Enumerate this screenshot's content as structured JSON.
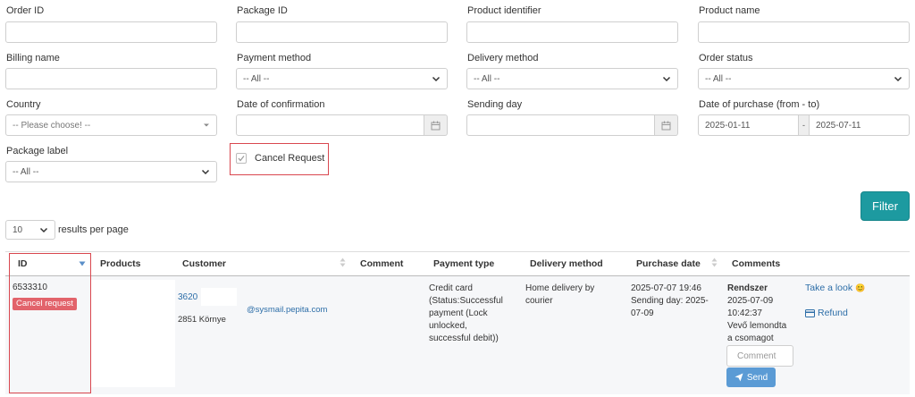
{
  "filters": {
    "order_id_label": "Order ID",
    "package_id_label": "Package ID",
    "product_identifier_label": "Product identifier",
    "product_name_label": "Product name",
    "billing_name_label": "Billing name",
    "payment_method_label": "Payment method",
    "payment_method_value": "-- All --",
    "delivery_method_label": "Delivery method",
    "delivery_method_value": "-- All --",
    "order_status_label": "Order status",
    "order_status_value": "-- All --",
    "country_label": "Country",
    "country_placeholder": "-- Please choose! --",
    "date_confirmation_label": "Date of confirmation",
    "sending_day_label": "Sending day",
    "date_purchase_label": "Date of purchase (from - to)",
    "date_from": "2025-01-11",
    "date_separator": "-",
    "date_to": "2025-07-11",
    "package_label_label": "Package label",
    "package_label_value": "-- All --",
    "cancel_request_label": "Cancel Request",
    "filter_button": "Filter"
  },
  "pagination": {
    "per_page_value": "10",
    "per_page_label": "results per page"
  },
  "table": {
    "headers": {
      "id": "ID",
      "products": "Products",
      "customer": "Customer",
      "comment": "Comment",
      "payment_type": "Payment type",
      "delivery_method": "Delivery method",
      "purchase_date": "Purchase date",
      "comments": "Comments"
    },
    "rows": [
      {
        "id": "6533310",
        "badge": "Cancel request",
        "customer_zip": "3620",
        "customer_email": "@sysmail.pepita.com",
        "customer_city": "2851 Környe",
        "payment_line1": "Credit card",
        "payment_line2": "(Status:Successful",
        "payment_line3": "payment (Lock",
        "payment_line4": "unlocked,",
        "payment_line5": "successful debit))",
        "delivery_line1": "Home delivery by",
        "delivery_line2": "courier",
        "purchase_date": "2025-07-07 19:46",
        "sending_line1": "Sending day: 2025-",
        "sending_line2": "07-09",
        "comment_author": "Rendszer",
        "comment_date": "2025-07-09",
        "comment_time": "10:42:37",
        "comment_text1": "Vevő lemondta",
        "comment_text2": "a csomagot",
        "comment_placeholder": "Comment",
        "send_button": "Send",
        "take_look": "Take a look",
        "take_look_emoji": "😊",
        "refund": "Refund"
      }
    ]
  },
  "colors": {
    "accent": "#1d9aa0",
    "link": "#2d6ea8",
    "highlight_border": "#d9474f",
    "badge": "#e2636b",
    "send_button": "#5b9bd5"
  }
}
